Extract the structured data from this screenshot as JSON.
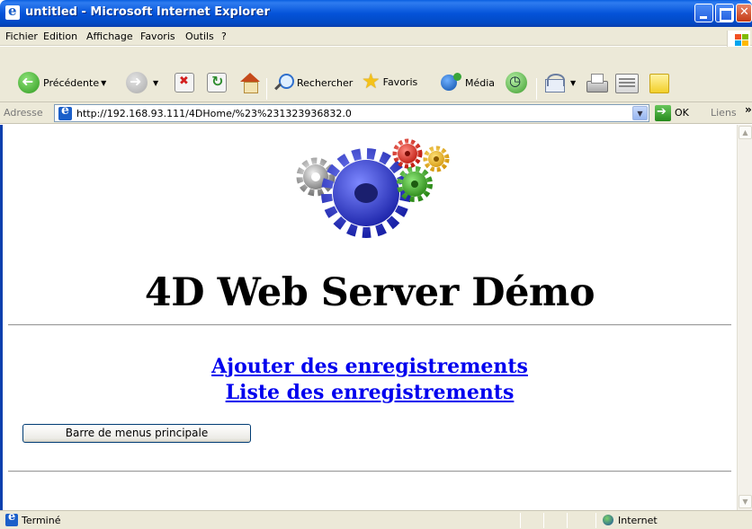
{
  "window": {
    "title": "untitled - Microsoft Internet Explorer"
  },
  "menu": {
    "items": [
      "Fichier",
      "Edition",
      "Affichage",
      "Favoris",
      "Outils",
      "?"
    ]
  },
  "toolbar": {
    "back_label": "Précédente",
    "search_label": "Rechercher",
    "favorites_label": "Favoris",
    "media_label": "Média",
    "icons": [
      "back-icon",
      "forward-icon",
      "stop-icon",
      "refresh-icon",
      "home-icon",
      "search-icon",
      "favorites-star-icon",
      "media-icon",
      "history-icon",
      "mail-icon",
      "print-icon",
      "edit-icon",
      "messenger-note-icon"
    ]
  },
  "address": {
    "label": "Adresse",
    "url": "http://192.168.93.111/4DHome/%23%231323936832.0",
    "go_label": "OK",
    "links_label": "Liens",
    "links_chevron": "»"
  },
  "page": {
    "heading": "4D Web Server Démo",
    "links": [
      "Ajouter des enregistrements",
      "Liste des enregistrements"
    ],
    "button_label": "Barre de menus principale"
  },
  "status": {
    "text": "Terminé",
    "zone": "Internet"
  },
  "colors": {
    "titlebar": "#0453d9",
    "link": "#0000ee",
    "chrome": "#ece9d8"
  }
}
